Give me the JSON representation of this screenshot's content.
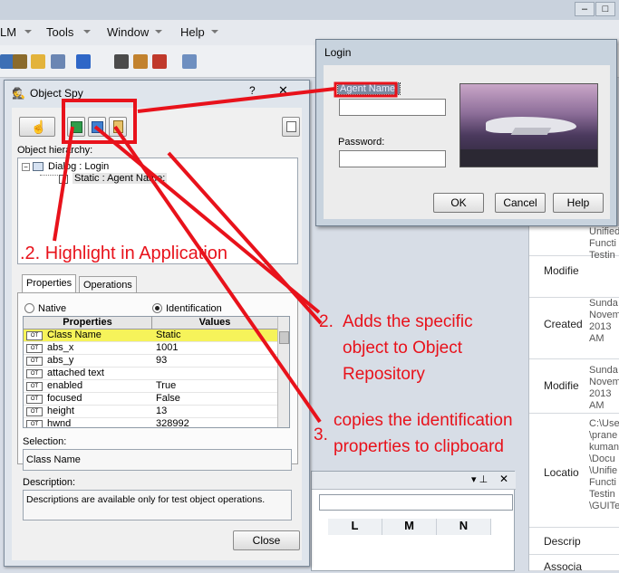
{
  "app": {
    "menu": [
      "LM",
      "Tools",
      "Window",
      "Help"
    ],
    "right_panel": [
      {
        "key": "",
        "value": "Unified\nFuncti\nTestin"
      },
      {
        "key": "Modifie",
        "value": ""
      },
      {
        "key": "Created",
        "value": "Sunda\nNovem\n2013\nAM"
      },
      {
        "key": "Modifie",
        "value": "Sunda\nNovem\n2013\nAM"
      },
      {
        "key": "Locatio",
        "value": "C:\\Use\n\\prane\nkuman\n\\Docu\n\\Unifie\nFuncti\nTestin\n\\GUITe"
      },
      {
        "key": "Descrip",
        "value": ""
      },
      {
        "key": "Associa",
        "value": ""
      }
    ],
    "sheet_columns": [
      "L",
      "M",
      "N"
    ]
  },
  "object_spy": {
    "title": "Object Spy",
    "help_glyph": "?",
    "close_glyph": "✕",
    "hierarchy_label": "Object hierarchy:",
    "tree": [
      "Dialog : Login",
      "Static : Agent Name:"
    ],
    "tabs": [
      "Properties",
      "Operations"
    ],
    "radio_native": "Native",
    "radio_identification": "Identification",
    "grid_headers": [
      "Properties",
      "Values"
    ],
    "rows": [
      {
        "name": "Class Name",
        "value": "Static"
      },
      {
        "name": "abs_x",
        "value": "1001"
      },
      {
        "name": "abs_y",
        "value": "93"
      },
      {
        "name": "attached text",
        "value": ""
      },
      {
        "name": "enabled",
        "value": "True"
      },
      {
        "name": "focused",
        "value": "False"
      },
      {
        "name": "height",
        "value": "13"
      },
      {
        "name": "hwnd",
        "value": "328992"
      }
    ],
    "selection_label": "Selection:",
    "selection_value": "Class Name",
    "description_label": "Description:",
    "description_value": "Descriptions are available only for test object operations.",
    "close_button": "Close"
  },
  "login": {
    "title": "Login",
    "agent_name_label": "Agent Name:",
    "password_label": "Password:",
    "ok": "OK",
    "cancel": "Cancel",
    "help": "Help"
  },
  "annotations": {
    "a1": ".2. Highlight in Application",
    "a2_num": "2.",
    "a2_text": "Adds the specific object to Object Repository",
    "a3_num": "3.",
    "a3_text": "copies the identification properties to clipboard"
  },
  "colors": {
    "annotation": "#e8121b",
    "highlight_row": "#f6f35a"
  }
}
